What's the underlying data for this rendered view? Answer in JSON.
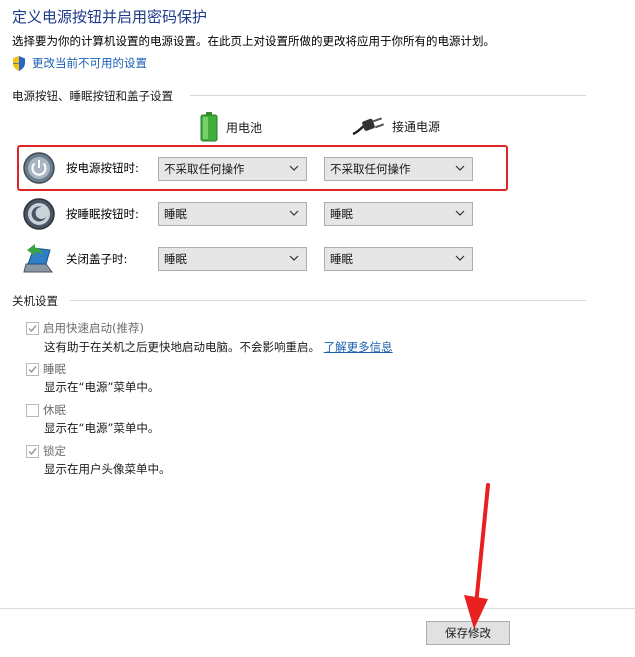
{
  "header": {
    "title": "定义电源按钮并启用密码保护",
    "subtitle": "选择要为你的计算机设置的电源设置。在此页上对设置所做的更改将应用于你所有的电源计划。",
    "change_link": "更改当前不可用的设置"
  },
  "power_group": {
    "title": "电源按钮、睡眠按钮和盖子设置",
    "col_battery": "用电池",
    "col_plugged": "接通电源",
    "rows": [
      {
        "label": "按电源按钮时:",
        "battery": "不采取任何操作",
        "plugged": "不采取任何操作"
      },
      {
        "label": "按睡眠按钮时:",
        "battery": "睡眠",
        "plugged": "睡眠"
      },
      {
        "label": "关闭盖子时:",
        "battery": "睡眠",
        "plugged": "睡眠"
      }
    ]
  },
  "shutdown_group": {
    "title": "关机设置",
    "items": [
      {
        "label": "启用快速启动(推荐)",
        "checked": true,
        "desc": "这有助于在关机之后更快地启动电脑。不会影响重启。",
        "link": "了解更多信息"
      },
      {
        "label": "睡眠",
        "checked": true,
        "desc": "显示在“电源”菜单中。"
      },
      {
        "label": "休眠",
        "checked": false,
        "desc": "显示在“电源”菜单中。"
      },
      {
        "label": "锁定",
        "checked": true,
        "desc": "显示在用户头像菜单中。"
      }
    ]
  },
  "footer": {
    "save_label": "保存修改"
  },
  "colors": {
    "accent": "#1e3a8a",
    "link": "#1a5fb4",
    "highlight": "#e02424"
  }
}
